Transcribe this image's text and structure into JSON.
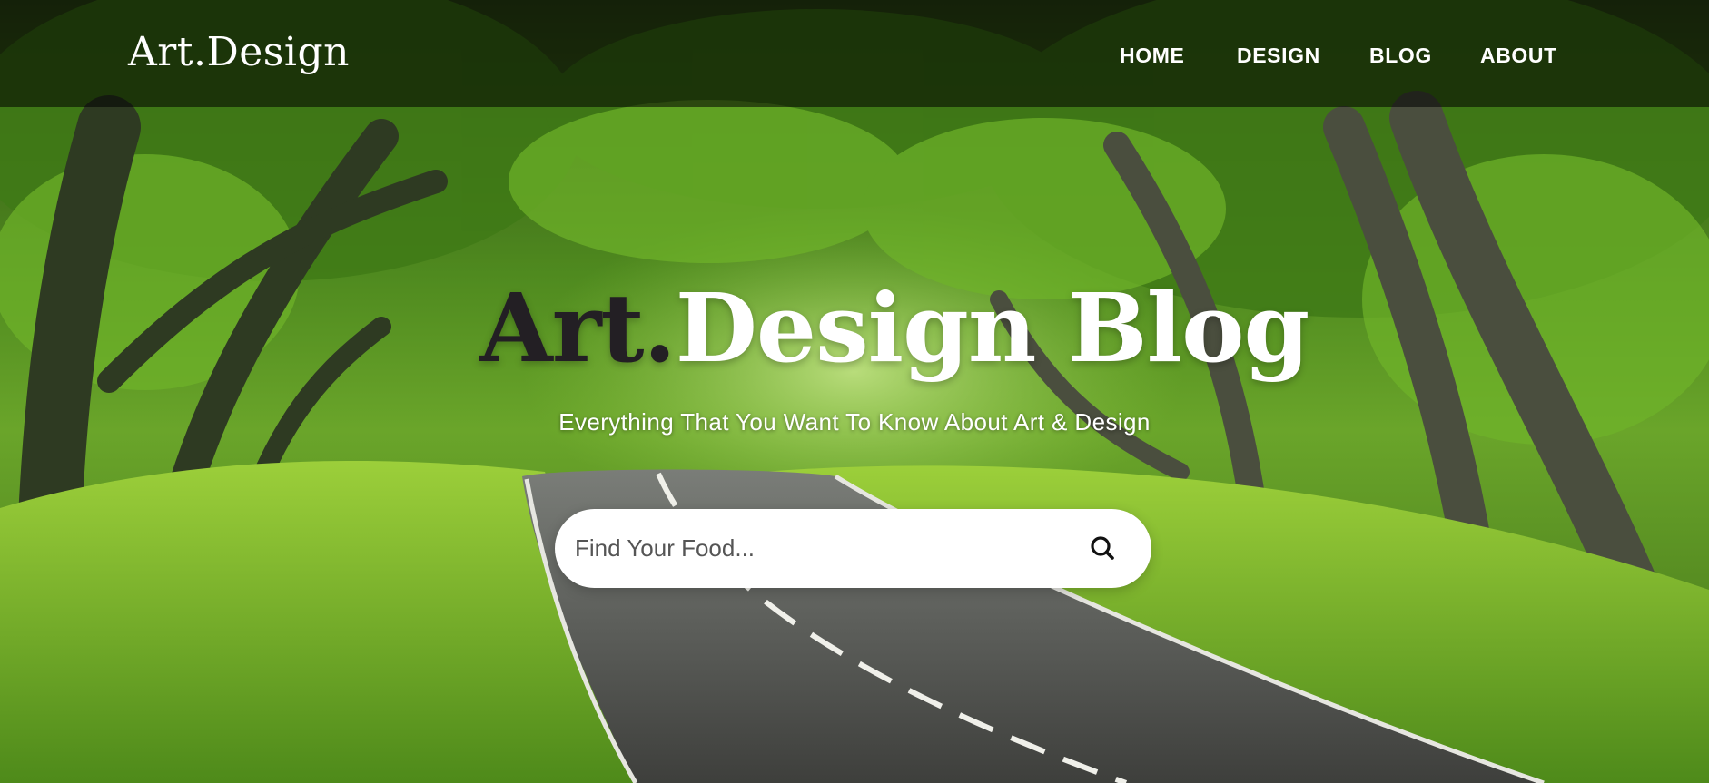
{
  "brand": {
    "logo": "Art.Design"
  },
  "nav": {
    "items": [
      {
        "label": "HOME"
      },
      {
        "label": "DESIGN"
      },
      {
        "label": "BLOG"
      },
      {
        "label": "ABOUT"
      }
    ]
  },
  "hero": {
    "title_part1": "Art.",
    "title_part2": "Design Blog",
    "subtitle": "Everything That You Want To Know About Art & Design"
  },
  "search": {
    "placeholder": "Find Your Food...",
    "value": "",
    "icon": "search-icon"
  },
  "colors": {
    "nav_bg": "#000000",
    "title_dark": "#231f24",
    "text_light": "#ffffff",
    "search_bg": "#ffffff"
  }
}
